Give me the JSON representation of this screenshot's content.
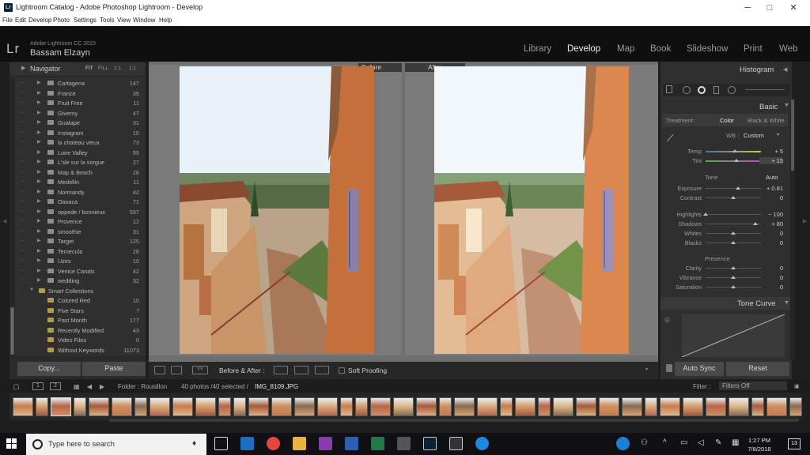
{
  "window": {
    "title": "Lightroom Catalog - Adobe Photoshop Lightroom - Develop",
    "app_icon": "Lr",
    "controls": {
      "minimize": "─",
      "maximize": "□",
      "close": "✕"
    }
  },
  "menu": [
    "File",
    "Edit",
    "Develop",
    "Photo",
    "Settings",
    "Tools",
    "View",
    "Window",
    "Help"
  ],
  "identity": {
    "logo": "Lr",
    "app_version": "Adobe Lightroom CC 2015",
    "user": "Bassam Elzayn"
  },
  "modules": [
    "Library",
    "Develop",
    "Map",
    "Book",
    "Slideshow",
    "Print",
    "Web"
  ],
  "active_module": "Develop",
  "navigator": {
    "title": "Navigator",
    "zoom": [
      "FIT",
      "FILL",
      "1:1",
      "1:1"
    ]
  },
  "collections": [
    {
      "name": "Cartagena",
      "count": "147"
    },
    {
      "name": "France",
      "count": "35"
    },
    {
      "name": "Fruit Free",
      "count": "11"
    },
    {
      "name": "Giverny",
      "count": "47"
    },
    {
      "name": "Guatape",
      "count": "31"
    },
    {
      "name": "Instagram",
      "count": "10"
    },
    {
      "name": "la chateau vieux",
      "count": "73"
    },
    {
      "name": "Loire Valley",
      "count": "95"
    },
    {
      "name": "L'sle sur la sorgue",
      "count": "27"
    },
    {
      "name": "Map & Beach",
      "count": "26"
    },
    {
      "name": "Medellin",
      "count": "11"
    },
    {
      "name": "Normandy",
      "count": "42"
    },
    {
      "name": "Oaxaca",
      "count": "71"
    },
    {
      "name": "oppede / bonnieux",
      "count": "597"
    },
    {
      "name": "Provence",
      "count": "12"
    },
    {
      "name": "smoothie",
      "count": "31"
    },
    {
      "name": "Target",
      "count": "125"
    },
    {
      "name": "Temecula",
      "count": "26"
    },
    {
      "name": "Uzes",
      "count": "10"
    },
    {
      "name": "Venice Canals",
      "count": "42"
    },
    {
      "name": "wedding",
      "count": "32"
    }
  ],
  "smart_collections": {
    "title": "Smart Collections",
    "items": [
      {
        "name": "Colored Red",
        "count": "10"
      },
      {
        "name": "Five Stars",
        "count": "7"
      },
      {
        "name": "Past Month",
        "count": "177"
      },
      {
        "name": "Recently Modified",
        "count": "43"
      },
      {
        "name": "Video Files",
        "count": "0"
      },
      {
        "name": "Without Keywords",
        "count": "11073"
      }
    ]
  },
  "left_buttons": {
    "copy": "Copy...",
    "paste": "Paste"
  },
  "compare": {
    "before": "Before",
    "after": "After"
  },
  "toolbar": {
    "before_after_label": "Before & After :",
    "soft_proofing": "Soft Proofing",
    "view_badge": "YY"
  },
  "right": {
    "histogram": "Histogram",
    "basic": "Basic",
    "treatment_label": "Treatment :",
    "treatment_color": "Color",
    "treatment_bw": "Black & White",
    "wb_label": "WB :",
    "wb_value": "Custom",
    "tone_label": "Tone",
    "tone_auto": "Auto",
    "presence_label": "Presence",
    "tone_curve": "Tone Curve",
    "auto_sync": "Auto Sync",
    "reset": "Reset",
    "sliders": [
      {
        "label": "Temp",
        "value": "+ 5",
        "pos": 0.53
      },
      {
        "label": "Tint",
        "value": "+ 15",
        "pos": 0.56
      },
      {
        "label": "Exposure",
        "value": "+ 0.81",
        "pos": 0.58
      },
      {
        "label": "Contrast",
        "value": "0",
        "pos": 0.5
      },
      {
        "label": "Highlights",
        "value": "− 100",
        "pos": 0.0
      },
      {
        "label": "Shadows",
        "value": "+ 80",
        "pos": 0.9
      },
      {
        "label": "Whites",
        "value": "0",
        "pos": 0.5
      },
      {
        "label": "Blacks",
        "value": "0",
        "pos": 0.5
      },
      {
        "label": "Clarity",
        "value": "0",
        "pos": 0.5
      },
      {
        "label": "Vibrance",
        "value": "0",
        "pos": 0.5
      },
      {
        "label": "Saturation",
        "value": "0",
        "pos": 0.5
      }
    ]
  },
  "filmbar": {
    "folder": "Folder : Rousillon",
    "count": "40 photos /40 selected /",
    "file": "IMG_8109.JPG",
    "filter_label": "Filter :",
    "filter_value": "Filters Off",
    "pages": [
      "1",
      "2"
    ]
  },
  "taskbar": {
    "search_placeholder": "Type here to search",
    "time": "1:27 PM",
    "date": "7/8/2018",
    "notif_count": "13"
  },
  "colors": {
    "accent": "#cfcfcf",
    "panel": "#2f2f2f",
    "center_bg": "#6f6f6f",
    "sky": "#e8f2f8",
    "wall": "#c88a52"
  }
}
